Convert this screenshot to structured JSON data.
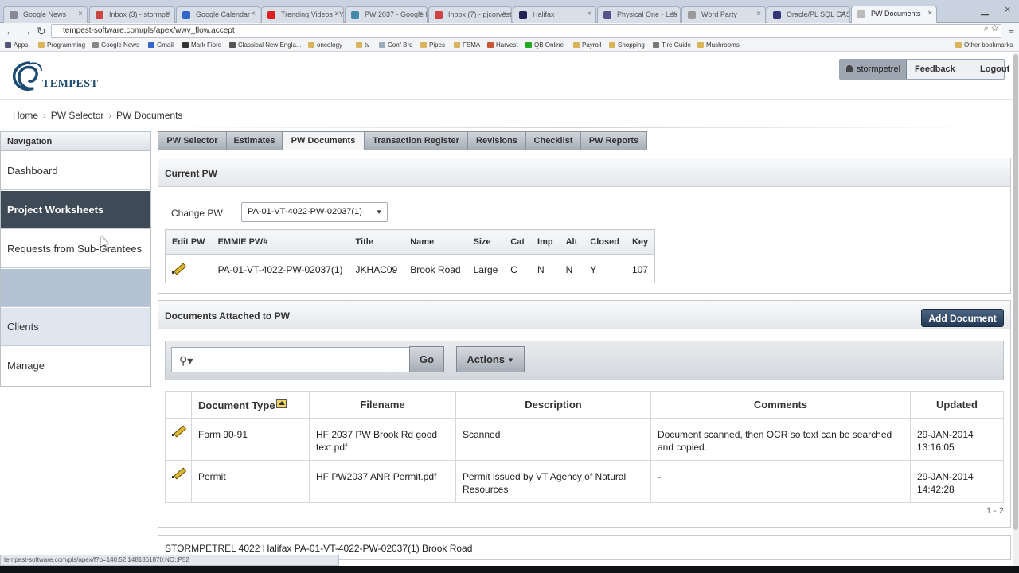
{
  "browser": {
    "tabs": [
      {
        "label": "Google News",
        "icon": "news-icon"
      },
      {
        "label": "Inbox (3) - stormpe",
        "icon": "mail-icon"
      },
      {
        "label": "Google Calendar",
        "icon": "calendar-icon"
      },
      {
        "label": "Trending Videos - Yo",
        "icon": "video-icon"
      },
      {
        "label": "PW 2037 - Google D",
        "icon": "doc-icon"
      },
      {
        "label": "Inbox (7) - pjcorvest",
        "icon": "mail-icon"
      },
      {
        "label": "Halifax",
        "icon": "page-icon"
      },
      {
        "label": "Physical One - Lea",
        "icon": "page-icon"
      },
      {
        "label": "Word Party",
        "icon": "page-icon"
      },
      {
        "label": "Oracle/PL SQL CAST",
        "icon": "page-icon"
      },
      {
        "label": "PW Documents",
        "icon": "page-icon",
        "active": true
      }
    ],
    "url": "tempest-software.com/pls/apex/wwv_flow.accept",
    "bookmarks": [
      "Apps",
      "Programming",
      "Google News",
      "Gmail",
      "Mark Fiore",
      "Classical New Engla...",
      "oncology",
      "tv",
      "Conf Brd",
      "Pipes",
      "FEMA",
      "Harvest",
      "QB Online",
      "Payroll",
      "Shopping",
      "Tire Guide",
      "Mushrooms",
      "Other bookmarks"
    ],
    "status_url": "tempest-software.com/pls/apex/f?p=140:52:1481861870:NO::P52"
  },
  "header": {
    "logo_text": "TEMPEST",
    "username": "stormpetrel",
    "feedback_label": "Feedback",
    "logout_label": "Logout"
  },
  "breadcrumb": [
    "Home",
    "PW Selector",
    "PW Documents"
  ],
  "navigation": {
    "title": "Navigation",
    "items": [
      {
        "label": "Dashboard",
        "state": "normal"
      },
      {
        "label": "Project Worksheets",
        "state": "selected"
      },
      {
        "label": "Requests from Sub-Grantees",
        "state": "normal"
      },
      {
        "label": "",
        "state": "blank"
      },
      {
        "label": "Clients",
        "state": "light"
      },
      {
        "label": "Manage",
        "state": "normal"
      }
    ]
  },
  "tabs": [
    "PW Selector",
    "Estimates",
    "PW Documents",
    "Transaction Register",
    "Revisions",
    "Checklist",
    "PW Reports"
  ],
  "active_tab": "PW Documents",
  "current_pw": {
    "title": "Current PW",
    "change_label": "Change PW",
    "selected_pw": "PA-01-VT-4022-PW-02037(1)",
    "columns": [
      "Edit PW",
      "EMMIE PW#",
      "Title",
      "Name",
      "Size",
      "Cat",
      "Imp",
      "Alt",
      "Closed",
      "Key"
    ],
    "row": [
      "PA-01-VT-4022-PW-02037(1)",
      "JKHAC09",
      "Brook Road",
      "Large",
      "C",
      "N",
      "N",
      "Y",
      "107"
    ]
  },
  "documents": {
    "title": "Documents Attached to PW",
    "add_label": "Add Document",
    "search_placeholder": "",
    "go_label": "Go",
    "actions_label": "Actions",
    "columns": [
      "Document Type",
      "Filename",
      "Description",
      "Comments",
      "Updated"
    ],
    "rows": [
      {
        "type": "Form 90-91",
        "filename": "HF 2037 PW Brook Rd good text.pdf",
        "description": "Scanned",
        "comments": "Document scanned, then OCR so text can be searched and copied.",
        "updated": "29-JAN-2014 13:16:05"
      },
      {
        "type": "Permit",
        "filename": "HF PW2037 ANR Permit.pdf",
        "description": "Permit issued by VT Agency of Natural Resources",
        "comments": "-",
        "updated": "29-JAN-2014 14:42:28"
      }
    ],
    "pagination": "1 - 2"
  },
  "footer": {
    "text": "STORMPETREL 4022 Halifax PA-01-VT-4022-PW-02037(1) Brook Road"
  }
}
